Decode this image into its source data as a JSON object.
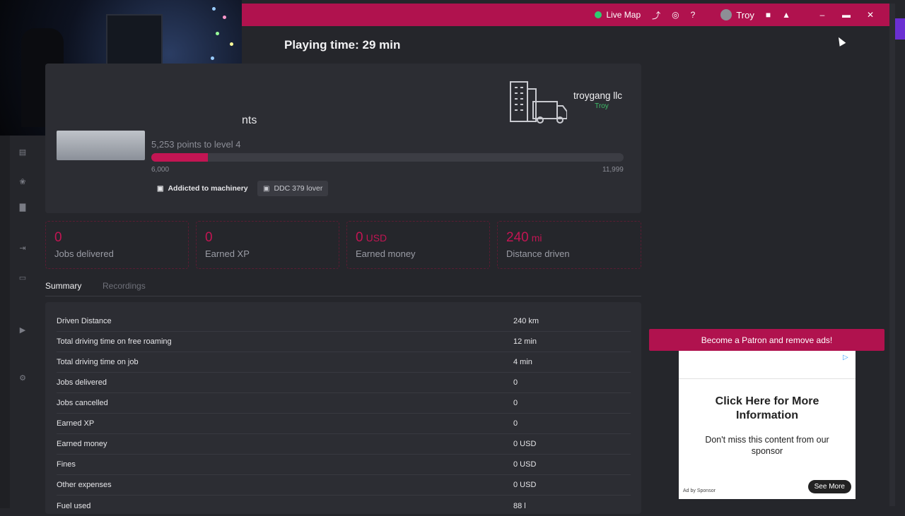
{
  "topbar": {
    "live_map": "Live Map",
    "user": "Troy"
  },
  "header": {
    "playing_time": "Playing time: 29 min"
  },
  "profile": {
    "rank_fragment": "nts",
    "points_to_level": "5,253 points to level 4",
    "progress_percent": 12,
    "range_low": "6,000",
    "range_high": "11,999",
    "badges": [
      "Addicted to machinery",
      "DDC 379 lover"
    ]
  },
  "company": {
    "name": "troygang llc",
    "owner": "Troy"
  },
  "stats": [
    {
      "value": "0",
      "unit": "",
      "label": "Jobs delivered"
    },
    {
      "value": "0",
      "unit": "",
      "label": "Earned XP"
    },
    {
      "value": "0",
      "unit": "USD",
      "label": "Earned money"
    },
    {
      "value": "240",
      "unit": "mi",
      "label": "Distance driven"
    }
  ],
  "tabs": [
    "Summary",
    "Recordings"
  ],
  "summary": [
    {
      "k": "Driven Distance",
      "v": "240 km"
    },
    {
      "k": "Total driving time on free roaming",
      "v": "12 min"
    },
    {
      "k": "Total driving time on job",
      "v": "4 min"
    },
    {
      "k": "Jobs delivered",
      "v": "0"
    },
    {
      "k": "Jobs cancelled",
      "v": "0"
    },
    {
      "k": "Earned XP",
      "v": "0"
    },
    {
      "k": "Earned money",
      "v": "0 USD"
    },
    {
      "k": "Fines",
      "v": "0 USD"
    },
    {
      "k": "Other expenses",
      "v": "0 USD"
    },
    {
      "k": "Fuel used",
      "v": "88 l"
    }
  ],
  "ad": {
    "patron": "Become a Patron and remove ads!",
    "headline": "Click Here for More Information",
    "desc": "Don't miss this content from our sponsor",
    "ad_by": "Ad by Sponsor",
    "cta": "See More"
  },
  "colors": {
    "accent": "#b0124e",
    "value_red": "#c21553",
    "online_green": "#2ecc71"
  }
}
